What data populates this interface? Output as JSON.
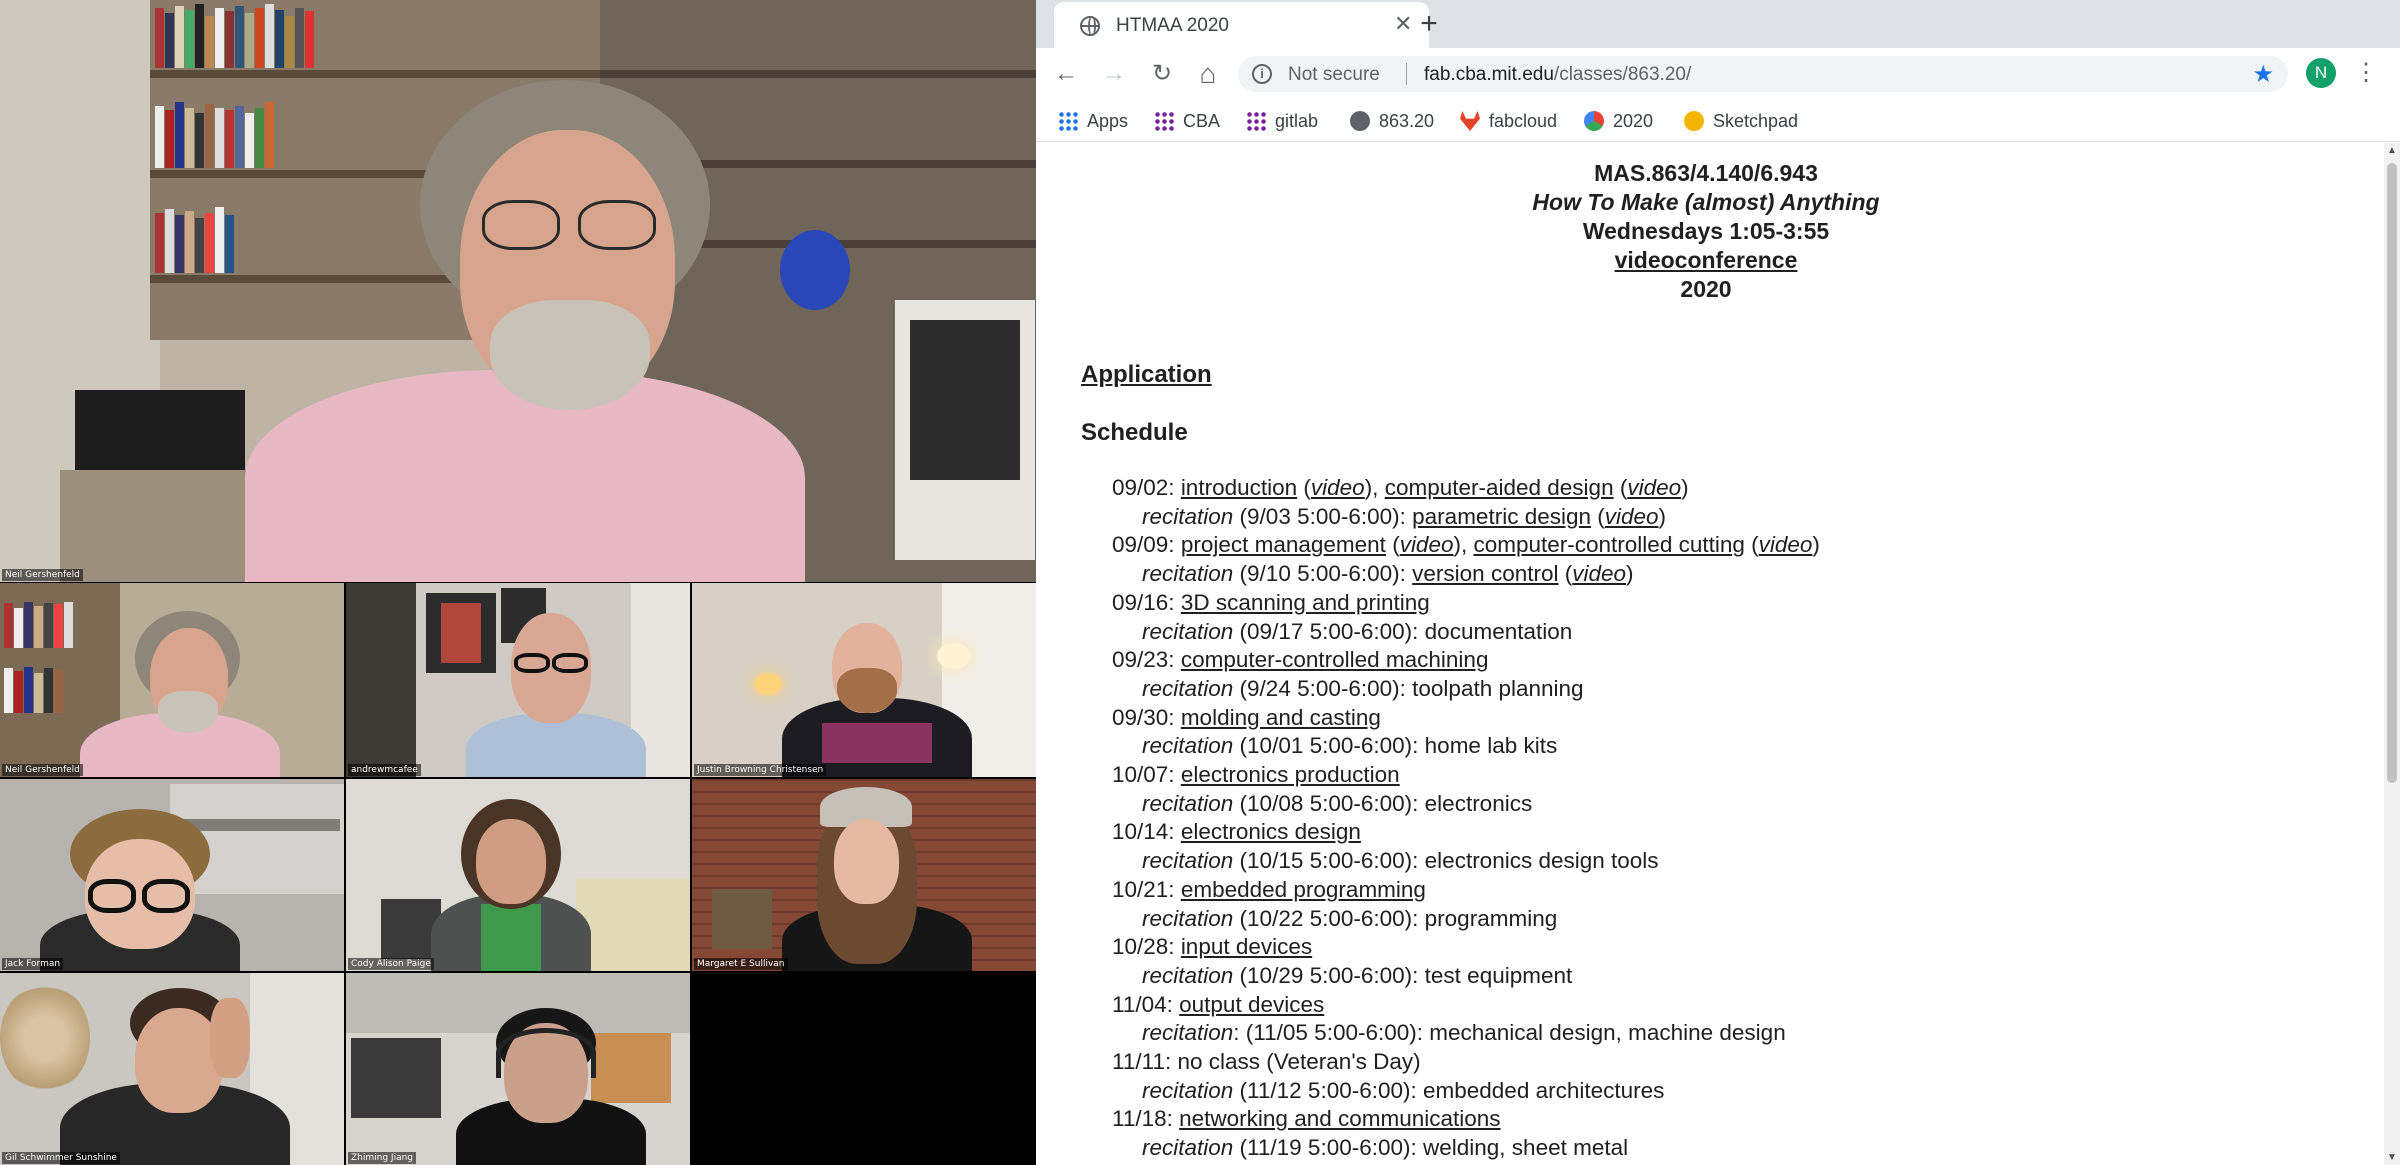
{
  "participants": [
    {
      "name": "Neil Gershenfeld",
      "tile": "main"
    },
    {
      "name": "Neil Gershenfeld",
      "tile": "g1"
    },
    {
      "name": "andrewmcafee",
      "tile": "g2"
    },
    {
      "name": "Justin Browning Christensen",
      "tile": "g3"
    },
    {
      "name": "Jack Forman",
      "tile": "g4"
    },
    {
      "name": "Cody Alison Paige",
      "tile": "g5"
    },
    {
      "name": "Margaret E Sullivan",
      "tile": "g6"
    },
    {
      "name": "Gil Schwimmer Sunshine",
      "tile": "g7"
    },
    {
      "name": "Zhiming Jiang",
      "tile": "g8"
    }
  ],
  "browser": {
    "tab_title": "HTMAA 2020",
    "tab_close": "✕",
    "new_tab": "+",
    "back": "←",
    "forward": "→",
    "reload": "↻",
    "home": "⌂",
    "not_secure": "Not secure",
    "url_host": "fab.cba.mit.edu",
    "url_path": "/classes/863.20/",
    "star": "★",
    "avatar_initial": "N",
    "menu": "⋮",
    "bookmarks": [
      {
        "label": "Apps",
        "icon": "apps-grid-icon",
        "color": "#1a73e8"
      },
      {
        "label": "CBA",
        "icon": "grid-icon",
        "color": "#7b1fa2"
      },
      {
        "label": "gitlab",
        "icon": "grid-icon",
        "color": "#7b1fa2"
      },
      {
        "label": "863.20",
        "icon": "globe-icon",
        "color": "#5f6368"
      },
      {
        "label": "fabcloud",
        "icon": "gitlab-fox-icon",
        "color": "#e24329"
      },
      {
        "label": "2020",
        "icon": "cloud-icon",
        "color": "#34a853"
      },
      {
        "label": "Sketchpad",
        "icon": "sketchpad-icon",
        "color": "#f4b400"
      }
    ]
  },
  "course": {
    "number": "MAS.863/4.140/6.943",
    "title": "How To Make (almost) Anything",
    "time": "Wednesdays 1:05-3:55",
    "location_link": "videoconference",
    "year": "2020",
    "application_link": "Application",
    "schedule_heading": "Schedule"
  },
  "schedule": [
    {
      "type": "date",
      "parts": [
        [
          "t",
          "09/02: "
        ],
        [
          "a",
          "introduction"
        ],
        [
          "t",
          " ("
        ],
        [
          "v",
          "video"
        ],
        [
          "t",
          "), "
        ],
        [
          "a",
          "computer-aided design"
        ],
        [
          "t",
          " ("
        ],
        [
          "v",
          "video"
        ],
        [
          "t",
          ")"
        ]
      ]
    },
    {
      "type": "rec",
      "parts": [
        [
          "i",
          "recitation"
        ],
        [
          "t",
          " (9/03 5:00-6:00): "
        ],
        [
          "a",
          "parametric design"
        ],
        [
          "t",
          " ("
        ],
        [
          "v",
          "video"
        ],
        [
          "t",
          ")"
        ]
      ]
    },
    {
      "type": "date",
      "parts": [
        [
          "t",
          "09/09: "
        ],
        [
          "a",
          "project management"
        ],
        [
          "t",
          " ("
        ],
        [
          "v",
          "video"
        ],
        [
          "t",
          "), "
        ],
        [
          "a",
          "computer-controlled cutting"
        ],
        [
          "t",
          " ("
        ],
        [
          "v",
          "video"
        ],
        [
          "t",
          ")"
        ]
      ]
    },
    {
      "type": "rec",
      "parts": [
        [
          "i",
          "recitation"
        ],
        [
          "t",
          " (9/10 5:00-6:00): "
        ],
        [
          "a",
          "version control"
        ],
        [
          "t",
          " ("
        ],
        [
          "v",
          "video"
        ],
        [
          "t",
          ")"
        ]
      ]
    },
    {
      "type": "date",
      "parts": [
        [
          "t",
          "09/16: "
        ],
        [
          "a",
          "3D scanning and printing"
        ]
      ]
    },
    {
      "type": "rec",
      "parts": [
        [
          "i",
          "recitation"
        ],
        [
          "t",
          " (09/17 5:00-6:00): documentation"
        ]
      ]
    },
    {
      "type": "date",
      "parts": [
        [
          "t",
          "09/23: "
        ],
        [
          "a",
          "computer-controlled machining"
        ]
      ]
    },
    {
      "type": "rec",
      "parts": [
        [
          "i",
          "recitation"
        ],
        [
          "t",
          " (9/24 5:00-6:00): toolpath planning"
        ]
      ]
    },
    {
      "type": "date",
      "parts": [
        [
          "t",
          "09/30: "
        ],
        [
          "a",
          "molding and casting"
        ]
      ]
    },
    {
      "type": "rec",
      "parts": [
        [
          "i",
          "recitation"
        ],
        [
          "t",
          " (10/01 5:00-6:00): home lab kits"
        ]
      ]
    },
    {
      "type": "date",
      "parts": [
        [
          "t",
          "10/07: "
        ],
        [
          "a",
          "electronics production"
        ]
      ]
    },
    {
      "type": "rec",
      "parts": [
        [
          "i",
          "recitation"
        ],
        [
          "t",
          " (10/08 5:00-6:00): electronics"
        ]
      ]
    },
    {
      "type": "date",
      "parts": [
        [
          "t",
          "10/14: "
        ],
        [
          "a",
          "electronics design"
        ]
      ]
    },
    {
      "type": "rec",
      "parts": [
        [
          "i",
          "recitation"
        ],
        [
          "t",
          " (10/15 5:00-6:00): electronics design tools"
        ]
      ]
    },
    {
      "type": "date",
      "parts": [
        [
          "t",
          "10/21: "
        ],
        [
          "a",
          "embedded programming"
        ]
      ]
    },
    {
      "type": "rec",
      "parts": [
        [
          "i",
          "recitation"
        ],
        [
          "t",
          " (10/22 5:00-6:00): programming"
        ]
      ]
    },
    {
      "type": "date",
      "parts": [
        [
          "t",
          "10/28: "
        ],
        [
          "a",
          "input devices"
        ]
      ]
    },
    {
      "type": "rec",
      "parts": [
        [
          "i",
          "recitation"
        ],
        [
          "t",
          " (10/29 5:00-6:00): test equipment"
        ]
      ]
    },
    {
      "type": "date",
      "parts": [
        [
          "t",
          "11/04: "
        ],
        [
          "a",
          "output devices"
        ]
      ]
    },
    {
      "type": "rec",
      "parts": [
        [
          "i",
          "recitation"
        ],
        [
          "t",
          ": (11/05 5:00-6:00): mechanical design, machine design"
        ]
      ]
    },
    {
      "type": "date",
      "parts": [
        [
          "t",
          "11/11: no class (Veteran's Day)"
        ]
      ]
    },
    {
      "type": "rec",
      "parts": [
        [
          "i",
          "recitation"
        ],
        [
          "t",
          " (11/12 5:00-6:00): embedded architectures"
        ]
      ]
    },
    {
      "type": "date",
      "parts": [
        [
          "t",
          "11/18: "
        ],
        [
          "a",
          "networking and communications"
        ]
      ]
    },
    {
      "type": "rec",
      "parts": [
        [
          "i",
          "recitation"
        ],
        [
          "t",
          " (11/19 5:00-6:00): welding, sheet metal"
        ]
      ]
    }
  ]
}
